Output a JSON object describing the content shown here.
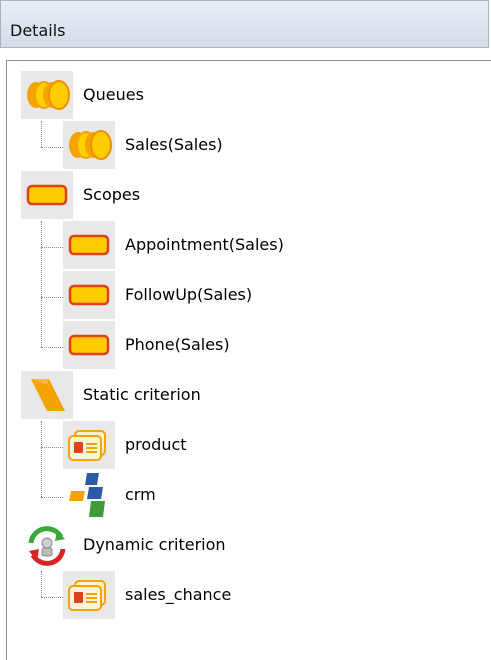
{
  "panel": {
    "title": "Details"
  },
  "tree": {
    "items": [
      {
        "label": "Queues",
        "icon": "queue-icon",
        "level": 0
      },
      {
        "label": "Sales(Sales)",
        "icon": "queue-icon",
        "level": 1
      },
      {
        "label": "Scopes",
        "icon": "scope-icon",
        "level": 0
      },
      {
        "label": "Appointment(Sales)",
        "icon": "scope-icon",
        "level": 1
      },
      {
        "label": "FollowUp(Sales)",
        "icon": "scope-icon",
        "level": 1
      },
      {
        "label": "Phone(Sales)",
        "icon": "scope-icon",
        "level": 1
      },
      {
        "label": "Static criterion",
        "icon": "static-criterion-icon",
        "level": 0
      },
      {
        "label": "product",
        "icon": "card-icon",
        "level": 1
      },
      {
        "label": "crm",
        "icon": "crm-logo-icon",
        "level": 1
      },
      {
        "label": "Dynamic criterion",
        "icon": "dynamic-criterion-icon",
        "level": 0
      },
      {
        "label": "sales_chance",
        "icon": "card-icon",
        "level": 1
      }
    ]
  },
  "colors": {
    "orange": "#f5a300",
    "yellow": "#ffcc00",
    "red_border": "#e0401a",
    "crm_blue": "#2b5aa8",
    "crm_green": "#3f9a3a",
    "refresh_red": "#d82424",
    "refresh_green": "#3aa83a"
  }
}
